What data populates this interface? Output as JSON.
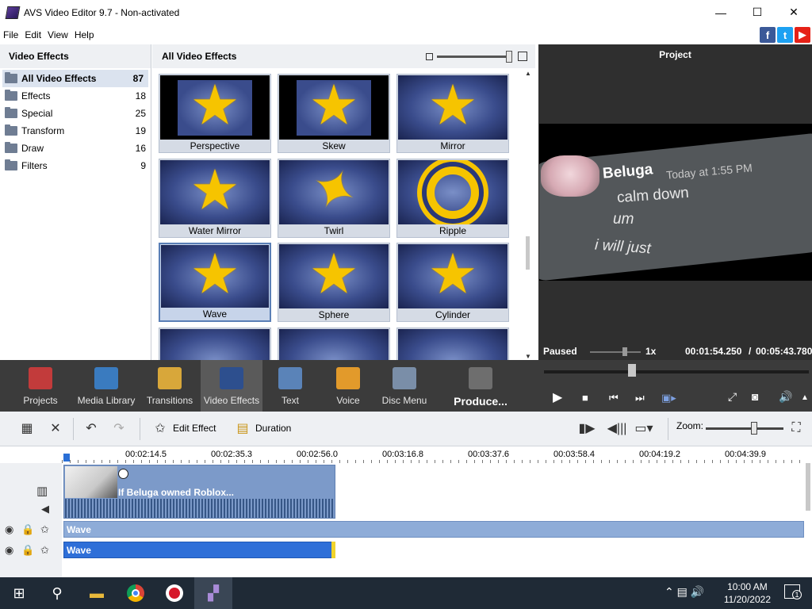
{
  "window": {
    "title": "AVS Video Editor 9.7 - Non-activated"
  },
  "menu": [
    "File",
    "Edit",
    "View",
    "Help"
  ],
  "social": [
    {
      "icon": "facebook-icon",
      "glyph": "f",
      "color": "#3b5998"
    },
    {
      "icon": "twitter-icon",
      "glyph": "t",
      "color": "#1da1f2"
    },
    {
      "icon": "youtube-icon",
      "glyph": "▶",
      "color": "#e62117"
    }
  ],
  "categories": {
    "title": "Video Effects",
    "items": [
      {
        "label": "All Video Effects",
        "count": "87",
        "active": true
      },
      {
        "label": "Effects",
        "count": "18"
      },
      {
        "label": "Special",
        "count": "25"
      },
      {
        "label": "Transform",
        "count": "19"
      },
      {
        "label": "Draw",
        "count": "16"
      },
      {
        "label": "Filters",
        "count": "9"
      }
    ]
  },
  "effects": {
    "title": "All Video Effects",
    "tiles": [
      {
        "label": "Perspective"
      },
      {
        "label": "Skew"
      },
      {
        "label": "Mirror"
      },
      {
        "label": "Water Mirror"
      },
      {
        "label": "Twirl"
      },
      {
        "label": "Ripple"
      },
      {
        "label": "Wave",
        "selected": true
      },
      {
        "label": "Sphere"
      },
      {
        "label": "Cylinder"
      },
      {
        "label": ""
      },
      {
        "label": ""
      },
      {
        "label": ""
      }
    ]
  },
  "preview": {
    "title": "Project",
    "video": {
      "name": "Beluga",
      "time": "Today at 1:55 PM",
      "lines": [
        "calm down",
        "um",
        "i will just"
      ]
    },
    "status": "Paused",
    "speed": "1x",
    "current_time": "00:01:54.250",
    "separator": "/",
    "total_time": "00:05:43.780"
  },
  "toolbar": {
    "tools": [
      {
        "label": "Projects",
        "icon": "projects-icon",
        "color": "#c23b3b"
      },
      {
        "label": "Media Library",
        "icon": "media-library-icon",
        "color": "#3a7bbf"
      },
      {
        "label": "Transitions",
        "icon": "transitions-icon",
        "color": "#d8a73a"
      },
      {
        "label": "Video Effects",
        "icon": "video-effects-icon",
        "color": "#2d4f8e",
        "active": true
      },
      {
        "label": "Text",
        "icon": "text-icon",
        "color": "#5a83b8"
      },
      {
        "label": "Voice",
        "icon": "voice-icon",
        "color": "#e29a2b"
      },
      {
        "label": "Disc Menu",
        "icon": "disc-menu-icon",
        "color": "#7a8ea8"
      },
      {
        "label": "Produce...",
        "icon": "produce-icon",
        "color": "#6e6e6e",
        "produce": true
      }
    ]
  },
  "timeline_toolbar": {
    "edit_effect": "Edit Effect",
    "duration": "Duration",
    "zoom_label": "Zoom:"
  },
  "ruler": [
    "00:02:14.5",
    "00:02:35.3",
    "00:02:56.0",
    "00:03:16.8",
    "00:03:37.6",
    "00:03:58.4",
    "00:04:19.2",
    "00:04:39.9"
  ],
  "tracks": {
    "clip_title": "If Beluga owned Roblox...",
    "effect_bar_1": "Wave",
    "effect_bar_2": "Wave"
  },
  "taskbar": {
    "time": "10:00 AM",
    "date": "11/20/2022",
    "notifications": "1"
  }
}
